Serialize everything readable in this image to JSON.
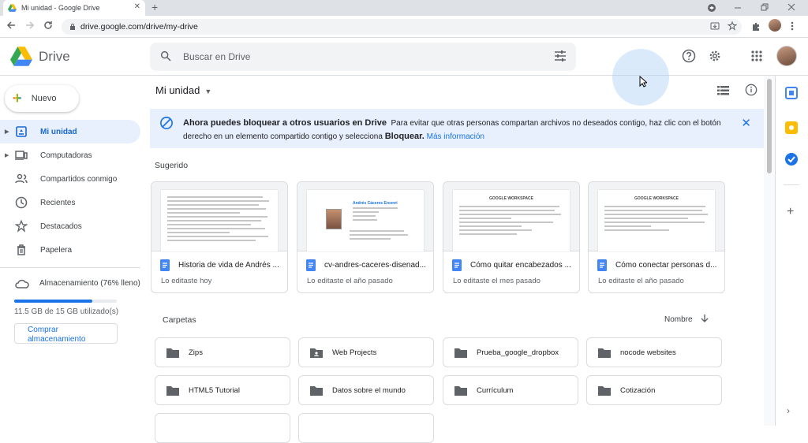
{
  "browser": {
    "tab_title": "Mi unidad - Google Drive",
    "tab_close": "✕",
    "new_tab": "+",
    "url": "drive.google.com/drive/my-drive"
  },
  "header": {
    "brand": "Drive",
    "search_placeholder": "Buscar en Drive"
  },
  "sidebar": {
    "new_label": "Nuevo",
    "items": [
      {
        "label": "Mi unidad",
        "icon": "my-drive-icon",
        "active": true
      },
      {
        "label": "Computadoras",
        "icon": "computer-icon"
      },
      {
        "label": "Compartidos conmigo",
        "icon": "shared-icon"
      },
      {
        "label": "Recientes",
        "icon": "clock-icon"
      },
      {
        "label": "Destacados",
        "icon": "star-icon"
      },
      {
        "label": "Papelera",
        "icon": "trash-icon"
      }
    ],
    "storage_label": "Almacenamiento (76% lleno)",
    "storage_fraction": 0.76,
    "storage_used": "11.5 GB de 15 GB utilizado(s)",
    "buy_label": "Comprar almacenamiento"
  },
  "main": {
    "breadcrumb": "Mi unidad",
    "banner": {
      "title": "Ahora puedes bloquear a otros usuarios en Drive",
      "text_a": "Para evitar que otras personas compartan archivos no deseados contigo, haz clic con el botón derecho en un elemento compartido contigo y selecciona",
      "text_bold": "Bloquear.",
      "link": "Más información"
    },
    "suggested_label": "Sugerido",
    "suggested": [
      {
        "name": "Historia de vida de Andrés ...",
        "sub": "Lo editaste hoy"
      },
      {
        "name": "cv-andres-caceres-disenad...",
        "sub": "Lo editaste el año pasado"
      },
      {
        "name": "Cómo quitar encabezados ...",
        "sub": "Lo editaste el mes pasado"
      },
      {
        "name": "Cómo conectar personas d...",
        "sub": "Lo editaste el año pasado"
      }
    ],
    "thumb_text": {
      "cv_name": "Andrés Cáceres Ercenri",
      "ws_title_1": "GOOGLE WORKSPACE",
      "ws_title_2": "GOOGLE WORKSPACE"
    },
    "folders_label": "Carpetas",
    "sort_label": "Nombre",
    "folders": [
      {
        "name": "Zips",
        "shared": false
      },
      {
        "name": "Web Projects",
        "shared": true
      },
      {
        "name": "Prueba_google_dropbox",
        "shared": false
      },
      {
        "name": "nocode websites",
        "shared": false
      },
      {
        "name": "HTML5 Tutorial",
        "shared": false
      },
      {
        "name": "Datos sobre el mundo",
        "shared": false
      },
      {
        "name": "Currículum",
        "shared": false
      },
      {
        "name": "Cotización",
        "shared": false
      }
    ]
  },
  "colors": {
    "accent": "#1a73e8",
    "active_bg": "#e8f0fe",
    "banner_bg": "#e8f0fe"
  }
}
